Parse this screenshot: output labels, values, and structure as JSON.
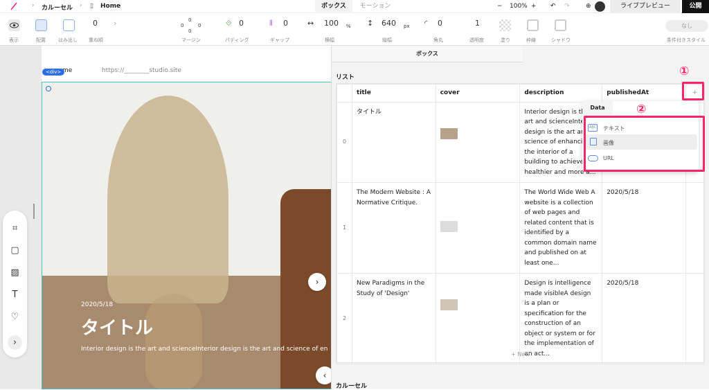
{
  "breadcrumb": {
    "project": "カルーセル",
    "page": "Home"
  },
  "top_tabs": {
    "box": "ボックス",
    "motion": "モーション"
  },
  "zoom": "100%",
  "live_preview": "ライブプレビュー",
  "publish": "公開",
  "toolbar": {
    "display": "表示",
    "placement": "配置",
    "overflow": "はみ出し",
    "stack_order": "重ね順",
    "stack_value": "0",
    "margin_label": "マージン",
    "margin_top": "0",
    "margin_left": "0",
    "margin_right": "0",
    "margin_bottom": "0",
    "padding_label": "パディング",
    "padding_value": "0",
    "gap_label": "ギャップ",
    "gap_value": "0",
    "width_label": "横幅",
    "width_value": "100",
    "width_unit": "%",
    "height_label": "縦幅",
    "height_value": "640",
    "height_unit": "px",
    "radius_label": "角丸",
    "radius_value": "0",
    "opacity_label": "透明度",
    "opacity_value": "1",
    "fill_label": "塗り",
    "border_label": "枠線",
    "shadow_label": "シャドウ",
    "cond_style_value": "なし",
    "cond_style_label": "条件付きスタイル"
  },
  "canvas": {
    "div_badge": "<div>",
    "nav_home": "me",
    "nav_url": "https://________studio.site",
    "slide_date": "2020/5/18",
    "slide_title": "タイトル",
    "slide_desc": "Interior design is the art and scienceInterior design is the art and science of en"
  },
  "left_tools": [
    "frame-icon",
    "box-icon",
    "image-icon",
    "text-icon",
    "heart-icon",
    "expand-icon"
  ],
  "panel": {
    "tab": "ボックス",
    "section_list": "リスト",
    "section_carousel": "カルーセル",
    "new_button": "+ New",
    "add_column": "+",
    "columns": [
      "title",
      "cover",
      "description",
      "publishedAt"
    ],
    "rows": [
      {
        "index": "0",
        "title": "タイトル",
        "description": "Interior design is the art and scienceInterior design is the art and science of enhancing the interior of a building to achieve a healthier and more a...",
        "publishedAt": "",
        "thumb_color": "#b7a18a"
      },
      {
        "index": "1",
        "title": "The Modern Website : A Normative Critique.",
        "description": "The World Wide Web A website is a collection of web pages and related content that is identified by a common domain name and published on at least one...",
        "publishedAt": "2020/5/18",
        "thumb_color": "#dcdcdc"
      },
      {
        "index": "2",
        "title": "New Paradigms in the Study of 'Design'",
        "description": "Design is intelligence made visibleA design is a plan or specification for the construction of an object or system or for the implementation of an act...",
        "publishedAt": "2020/5/18",
        "thumb_color": "#cfc6b8"
      }
    ],
    "data_menu": {
      "title": "Data",
      "items": [
        {
          "icon": "ABC",
          "label": "テキスト"
        },
        {
          "icon": "image",
          "label": "画像"
        },
        {
          "icon": "link",
          "label": "URL"
        }
      ]
    }
  },
  "annotations": {
    "one": "①",
    "two": "②"
  },
  "colors": {
    "accent": "#ff2266",
    "badge": "#2b6fe8"
  }
}
